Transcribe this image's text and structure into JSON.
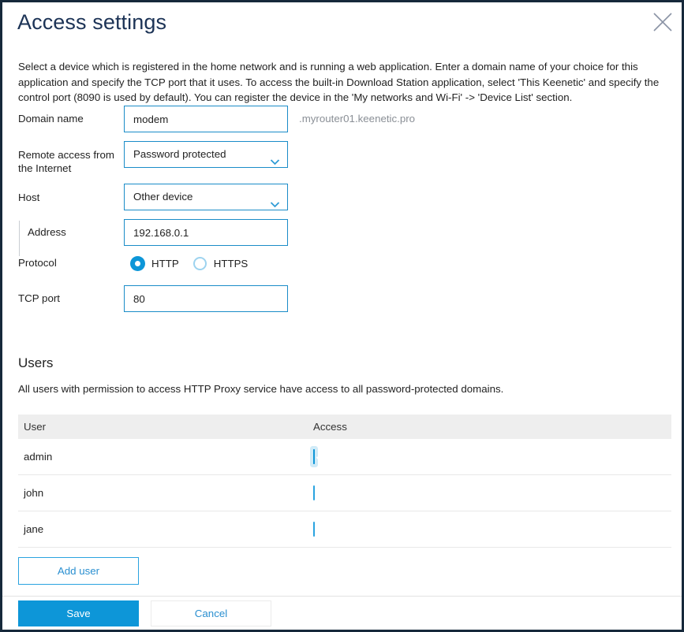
{
  "dialog": {
    "title": "Access settings",
    "close_label": "×",
    "description": "Select a device which is registered in the home network and is running a web application. Enter a domain name of your choice for this application and specify the TCP port that it uses. To access the built-in Download Station application, select 'This Keenetic' and specify the control port (8090 is used by default). You can register the device in the 'My networks and Wi-Fi' -> 'Device List' section."
  },
  "form": {
    "domain_name": {
      "label": "Domain name",
      "value": "modem",
      "placeholder": "",
      "suffix": ".myrouter01.keenetic.pro"
    },
    "remote_access": {
      "label": "Remote access from the Internet",
      "value": "Password protected"
    },
    "host": {
      "label": "Host",
      "value": "Other device"
    },
    "address": {
      "label": "Address",
      "value": "192.168.0.1",
      "placeholder": ""
    },
    "protocol": {
      "label": "Protocol",
      "options": [
        {
          "label": "HTTP",
          "selected": true
        },
        {
          "label": "HTTPS",
          "selected": false
        }
      ]
    },
    "tcp_port": {
      "label": "TCP port",
      "value": "80",
      "placeholder": ""
    }
  },
  "users": {
    "heading": "Users",
    "note": "All users with permission to access HTTP Proxy service have access to all password-protected domains.",
    "columns": [
      "User",
      "Access"
    ],
    "rows": [
      {
        "user": "admin",
        "access": true
      },
      {
        "user": "john",
        "access": false
      },
      {
        "user": "jane",
        "access": false
      }
    ],
    "add_user_label": "Add user"
  },
  "footer": {
    "save_label": "Save",
    "cancel_label": "Cancel"
  },
  "colors": {
    "accent": "#0d96d8",
    "border_accent": "#1a8cc8",
    "title": "#1c3356",
    "frame": "#16293b",
    "muted_text": "#8a8f96",
    "table_header_bg": "#eeeeee"
  }
}
